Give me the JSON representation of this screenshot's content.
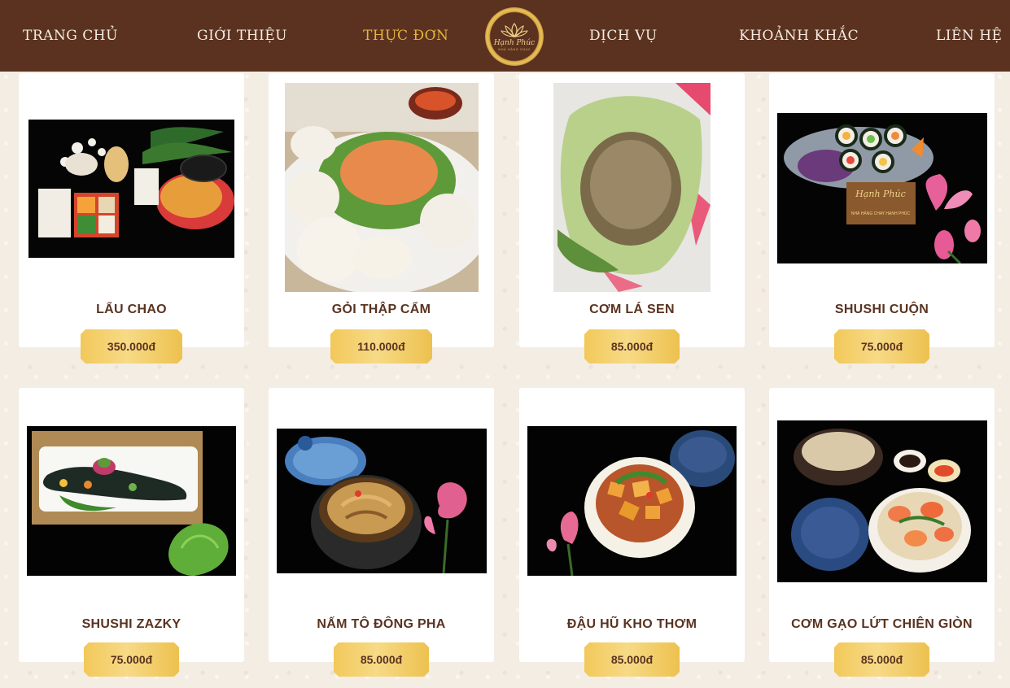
{
  "nav": {
    "items": [
      {
        "label": "TRANG CHỦ",
        "active": false
      },
      {
        "label": "GIỚI THIỆU",
        "active": false
      },
      {
        "label": "THỰC ĐƠN",
        "active": true
      },
      {
        "label": "DỊCH VỤ",
        "active": false
      },
      {
        "label": "KHOẢNH KHẮC",
        "active": false
      },
      {
        "label": "LIÊN HỆ",
        "active": false
      }
    ],
    "logo": {
      "name": "Hạnh Phúc",
      "subtitle": "NHÀ HÀNG CHAY"
    }
  },
  "menu": [
    {
      "name": "LẨU CHAO",
      "price": "350.000đ",
      "photo": "hotpot-platter"
    },
    {
      "name": "GỎI THẬP CẨM",
      "price": "110.000đ",
      "photo": "mixed-salad"
    },
    {
      "name": "CƠM LÁ SEN",
      "price": "85.000đ",
      "photo": "lotus-leaf-rice"
    },
    {
      "name": "SHUSHI CUỘN",
      "price": "75.000đ",
      "photo": "sushi-rolls"
    },
    {
      "name": "SHUSHI ZAZKY",
      "price": "75.000đ",
      "photo": "sushi-zazky"
    },
    {
      "name": "NẤM TÔ ĐÔNG PHA",
      "price": "85.000đ",
      "photo": "mushroom-pot"
    },
    {
      "name": "ĐẬU HŨ KHO THƠM",
      "price": "85.000đ",
      "photo": "braised-tofu"
    },
    {
      "name": "CƠM GẠO LỨT CHIÊN GIÒN",
      "price": "85.000đ",
      "photo": "crispy-brown-rice"
    }
  ],
  "photo_card_text": {
    "name": "Hạnh Phúc",
    "subtitle": "NHÀ HÀNG CHAY HẠNH PHÚC"
  },
  "colors": {
    "nav_bg": "#5b3220",
    "active": "#e6b43a",
    "price_gold": "#f2c85a",
    "text_brown": "#5a3320"
  }
}
